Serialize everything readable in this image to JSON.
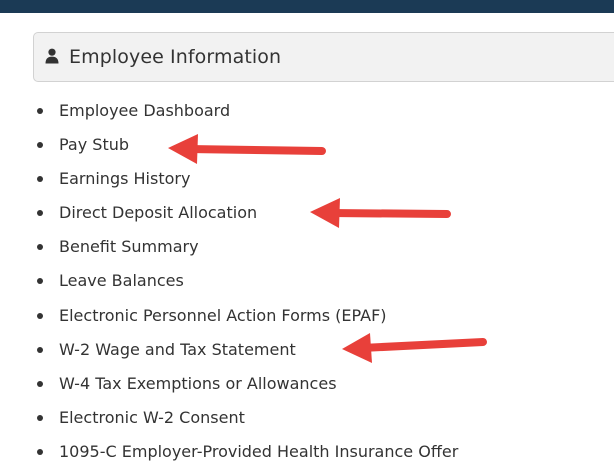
{
  "panel": {
    "icon": "user-icon",
    "title": "Employee Information"
  },
  "menu": {
    "items": [
      {
        "label": "Employee Dashboard"
      },
      {
        "label": "Pay Stub"
      },
      {
        "label": "Earnings History"
      },
      {
        "label": "Direct Deposit Allocation"
      },
      {
        "label": "Benefit Summary"
      },
      {
        "label": "Leave Balances"
      },
      {
        "label": "Electronic Personnel Action Forms (EPAF)"
      },
      {
        "label": "W-2 Wage and Tax Statement"
      },
      {
        "label": "W-4 Tax Exemptions or Allowances"
      },
      {
        "label": "Electronic W-2 Consent"
      },
      {
        "label": "1095-C Employer-Provided Health Insurance Offer"
      }
    ]
  },
  "annotations": {
    "arrow_color": "#e8403a",
    "highlighted_items": [
      "Pay Stub",
      "Direct Deposit Allocation",
      "W-2 Wage and Tax Statement"
    ]
  },
  "colors": {
    "top_bar": "#1b3a55",
    "panel_background": "#f2f2f2",
    "text": "#333333"
  }
}
